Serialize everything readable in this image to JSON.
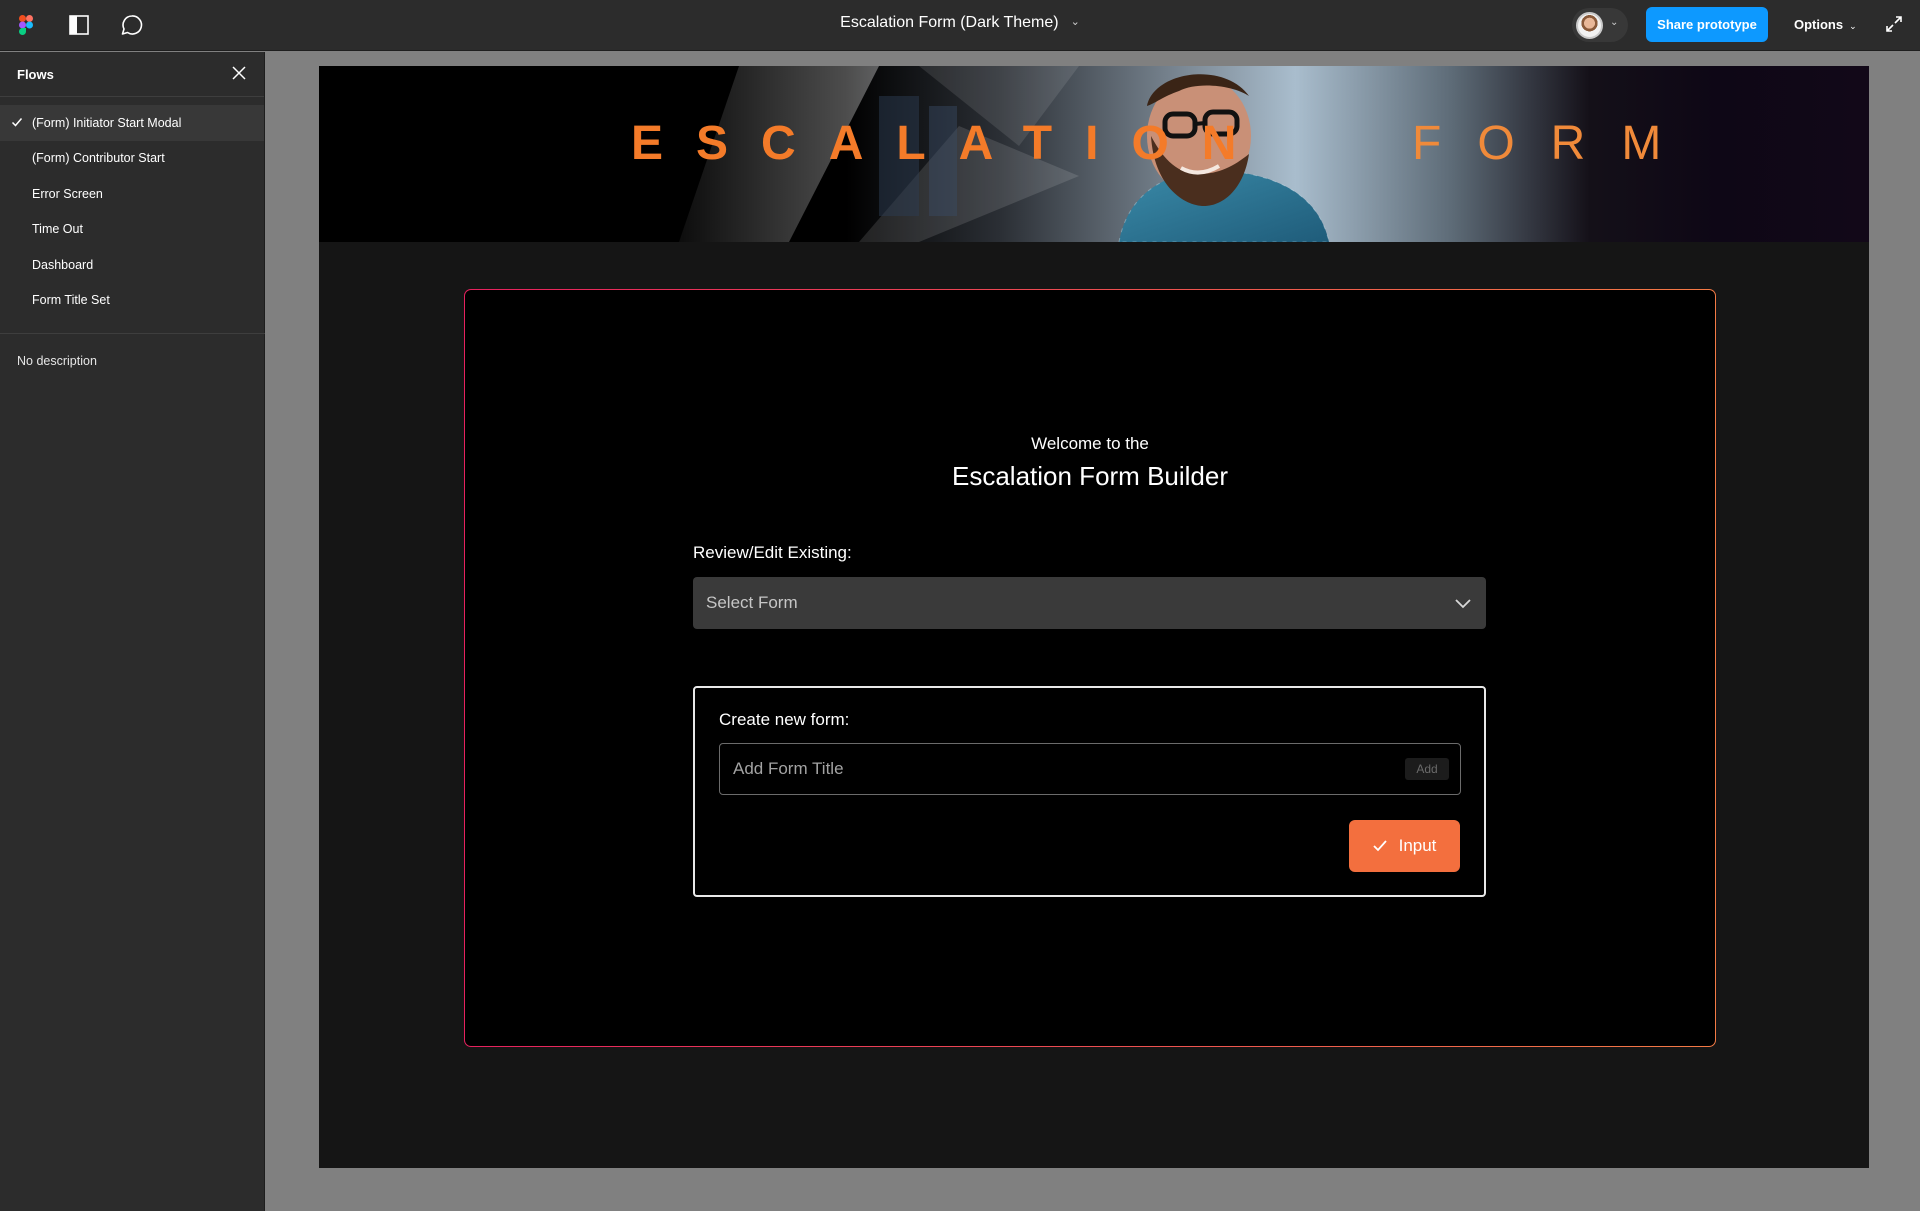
{
  "topbar": {
    "document_title": "Escalation Form (Dark Theme)",
    "share_label": "Share prototype",
    "options_label": "Options",
    "icons": [
      "figma-logo-icon",
      "sidebar-toggle-icon",
      "comment-icon",
      "chevron-down-icon",
      "expand-icon"
    ]
  },
  "sidebar": {
    "title": "Flows",
    "items": [
      {
        "label": "(Form) Initiator Start Modal",
        "selected": true
      },
      {
        "label": "(Form) Contributor Start",
        "selected": false
      },
      {
        "label": "Error Screen",
        "selected": false
      },
      {
        "label": "Time Out",
        "selected": false
      },
      {
        "label": "Dashboard",
        "selected": false
      },
      {
        "label": "Form Title Set",
        "selected": false
      }
    ],
    "description": "No description"
  },
  "banner": {
    "word1": "ESCALATION",
    "word2": "FORM",
    "accent_color": "#f47b29"
  },
  "modal": {
    "welcome": "Welcome to the",
    "heading": "Escalation Form Builder",
    "review_label": "Review/Edit Existing:",
    "select_value": "Select Form",
    "create_label": "Create new form:",
    "title_placeholder": "Add Form Title",
    "add_chip": "Add",
    "input_button": "Input",
    "button_color": "#f36f3e",
    "border_colors": [
      "#e6215e",
      "#f37a45"
    ]
  },
  "colors": {
    "share_button": "#0d99ff",
    "toolbar_bg": "#2c2c2c",
    "canvas_bg": "#808080"
  }
}
